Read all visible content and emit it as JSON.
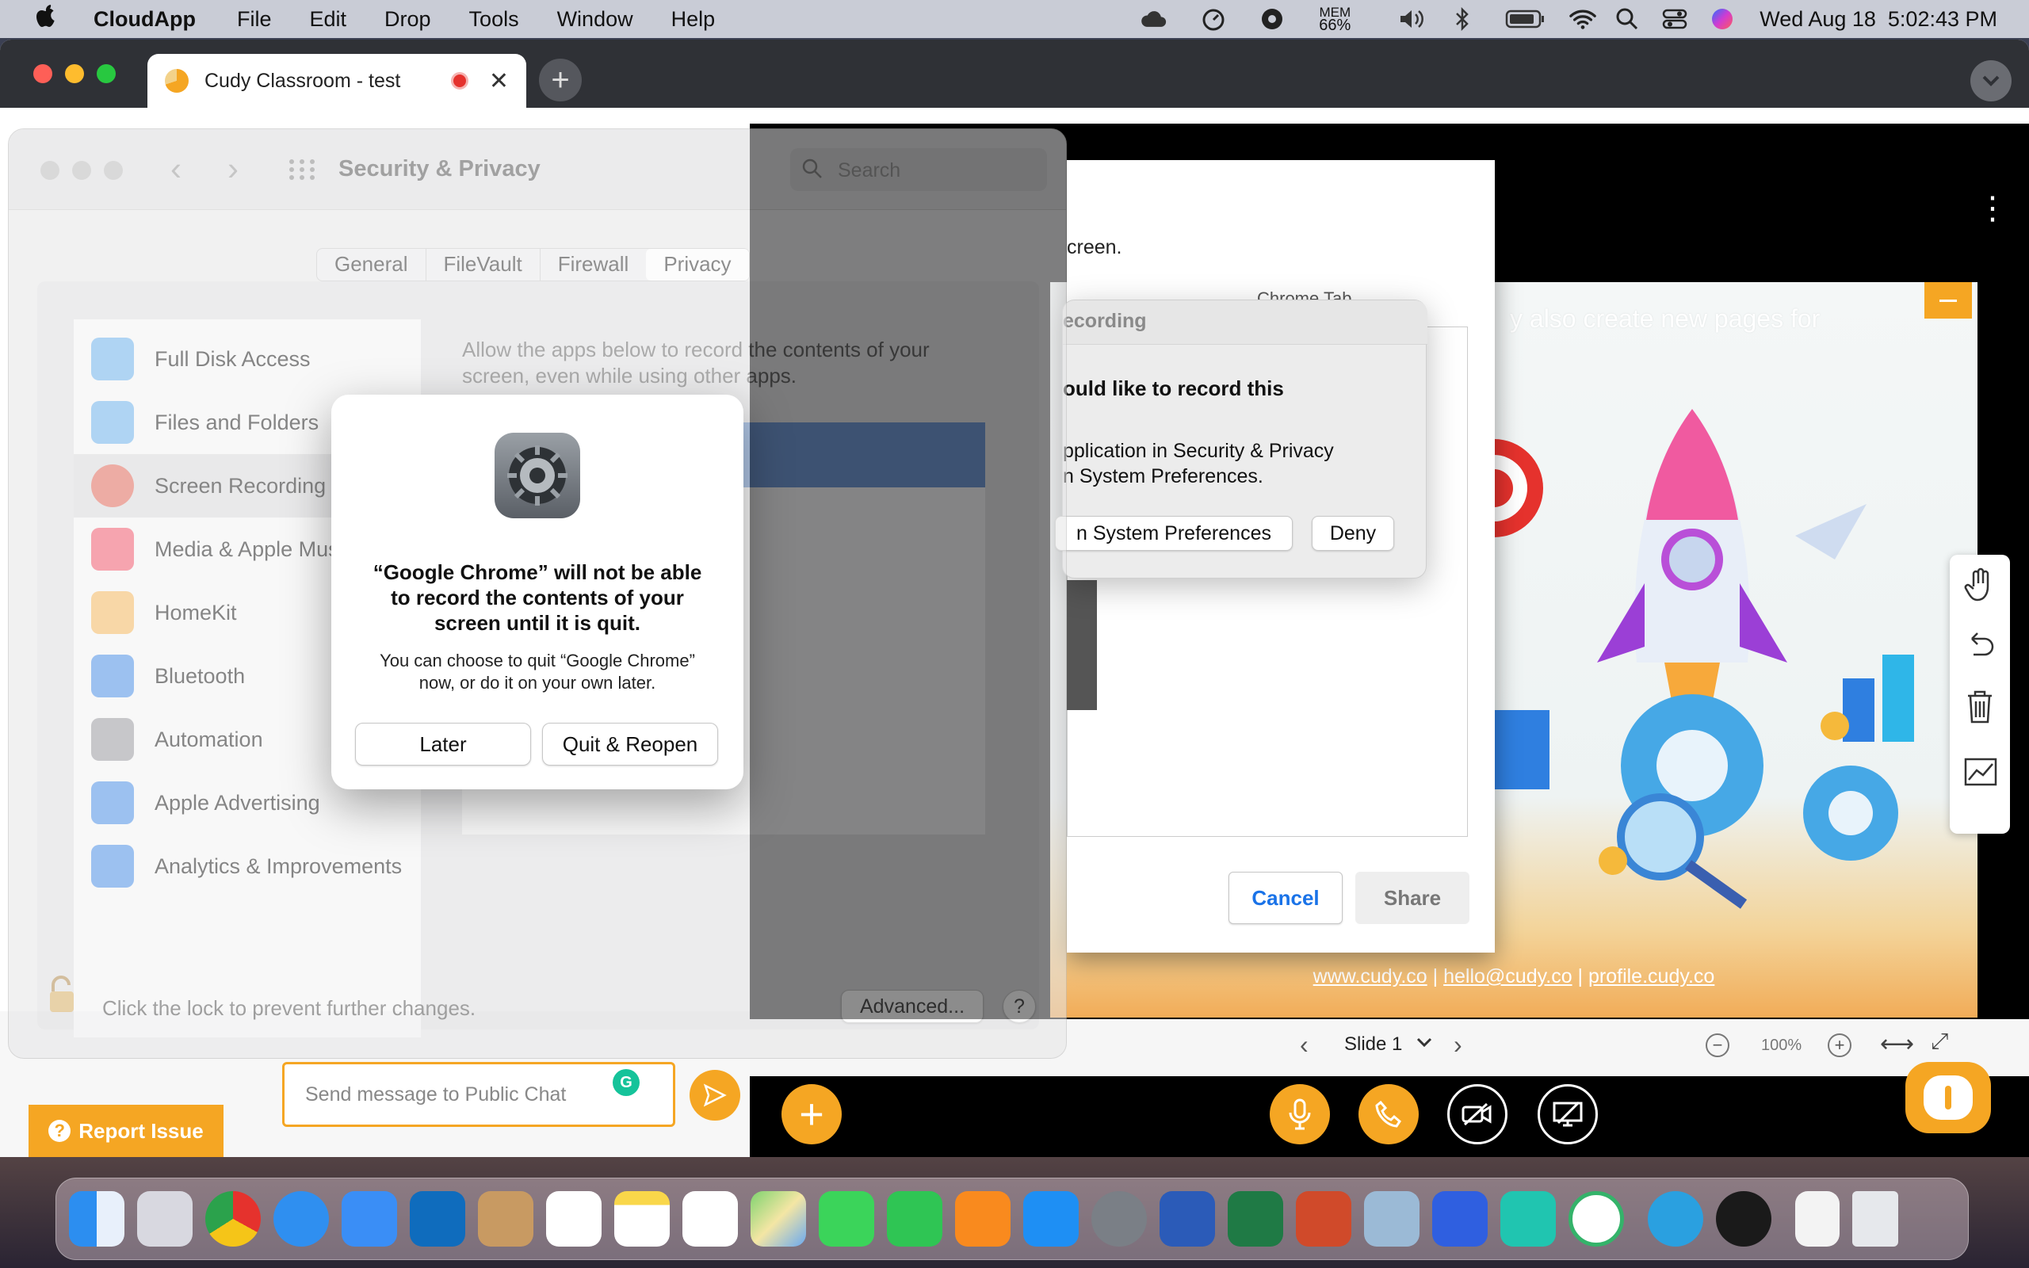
{
  "menubar": {
    "app_name": "CloudApp",
    "items": [
      "File",
      "Edit",
      "Drop",
      "Tools",
      "Window",
      "Help"
    ],
    "mem_label": "MEM",
    "mem_value": "66%",
    "datetime": "Wed Aug 18  5:02:43 PM"
  },
  "browser": {
    "tab_title": "Cudy Classroom - test"
  },
  "sysprefs": {
    "title": "Security & Privacy",
    "search_placeholder": "Search",
    "tabs": [
      "General",
      "FileVault",
      "Firewall",
      "Privacy"
    ],
    "selected_tab": "Privacy",
    "description": "Allow the apps below to record the contents of your screen, even while using other apps.",
    "sidebar": [
      {
        "label": "Full Disk Access",
        "color": "#5aa7e6"
      },
      {
        "label": "Files and Folders",
        "color": "#5aa7e6"
      },
      {
        "label": "Screen Recording",
        "color": "#e06a5a"
      },
      {
        "label": "Media & Apple Music",
        "color": "#f05a6e"
      },
      {
        "label": "HomeKit",
        "color": "#f0a040"
      },
      {
        "label": "Bluetooth",
        "color": "#3b82e0"
      },
      {
        "label": "Automation",
        "color": "#8e8e93"
      },
      {
        "label": "Apple Advertising",
        "color": "#3b82e0"
      },
      {
        "label": "Analytics & Improvements",
        "color": "#3b82e0"
      }
    ],
    "lock_text": "Click the lock to prevent further changes.",
    "advanced_label": "Advanced...",
    "help_label": "?"
  },
  "alert": {
    "title": "“Google Chrome” will not be able to record the contents of your screen until it is quit.",
    "message": "You can choose to quit “Google Chrome” now, or do it on your own later.",
    "later_label": "Later",
    "quit_label": "Quit & Reopen"
  },
  "share_dialog": {
    "partial_text": "creen.",
    "partial_tab": "Chrome Tab",
    "cancel_label": "Cancel",
    "share_label": "Share"
  },
  "rec_prompt": {
    "title": "ecording",
    "heading": "ould like to record this",
    "body_line1": "pplication in Security & Privacy",
    "body_line2": "n System Preferences.",
    "open_label": "n System Preferences",
    "deny_label": "Deny"
  },
  "slide": {
    "overlay_text": "y also create new pages for",
    "links": [
      "www.cudy.co",
      "hello@cudy.co",
      "profile.cudy.co"
    ],
    "separator": "|",
    "slide_label": "Slide 1",
    "zoom": "100%"
  },
  "chat": {
    "placeholder": "Send message to Public Chat",
    "report_label": "Report Issue"
  },
  "colors": {
    "accent": "#f5a623",
    "link": "#2464c8"
  }
}
